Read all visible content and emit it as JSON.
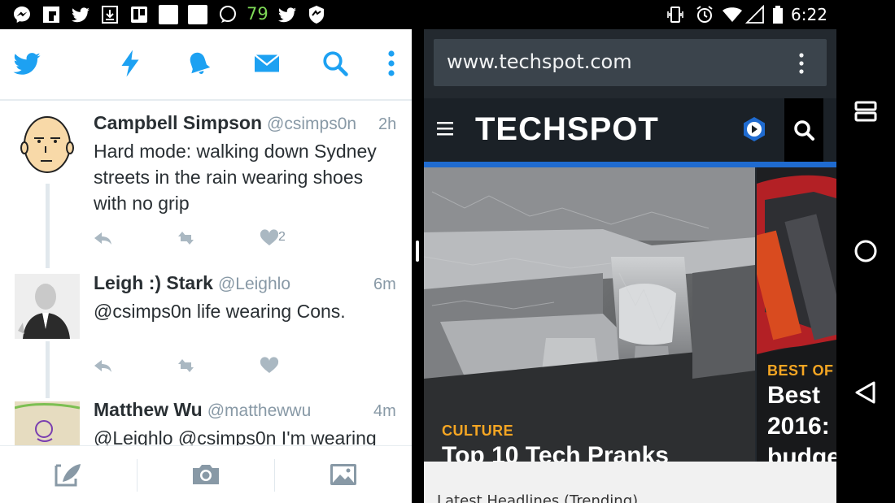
{
  "status_bar": {
    "icons": [
      "messenger-icon",
      "flipboard-icon",
      "twitter-icon",
      "download-icon",
      "trello-icon",
      "blank-square-icon",
      "blank-square-icon",
      "chat-bubble-icon"
    ],
    "notification_count": "79",
    "right_icons": [
      "vibrate-icon",
      "alarm-icon",
      "wifi-icon",
      "cell-signal-icon",
      "battery-icon"
    ],
    "time": "6:22"
  },
  "twitter": {
    "header_icons": [
      "twitter-logo-icon",
      "lightning-icon",
      "notifications-bell-icon",
      "messages-envelope-icon",
      "search-icon",
      "overflow-menu-icon"
    ],
    "accent_color": "#1da1f2",
    "tweets": [
      {
        "name": "Campbell Simpson",
        "handle": "@csimps0n",
        "time": "2h",
        "text_lines": [
          "Hard mode: walking down Sydney",
          "streets in the rain wearing shoes",
          "with no grip"
        ],
        "like_count": "2"
      },
      {
        "name": "Leigh :) Stark",
        "handle": "@Leighlo",
        "time": "6m",
        "text_lines": [
          "@csimps0n life wearing Cons."
        ],
        "like_count": ""
      },
      {
        "name": "Matthew Wu",
        "handle": "@matthewwu",
        "time": "4m",
        "text_lines": [
          "@Leighlo @csimps0n I'm wearing"
        ],
        "like_count": ""
      }
    ],
    "compose_icons": [
      "compose-tweet-icon",
      "camera-icon",
      "gallery-icon"
    ]
  },
  "browser": {
    "url": "www.techspot.com",
    "site_logo": "TECHSPOT",
    "articles": [
      {
        "category": "CULTURE",
        "headline": "Top 10 Tech Pranks"
      },
      {
        "category": "BEST OF",
        "headline_lines": [
          "Best",
          "2016:",
          "budge"
        ]
      }
    ],
    "below_text": "Latest Headlines  (Trending)"
  },
  "nav_bar": {
    "icons": [
      "recents-icon",
      "home-icon",
      "back-icon"
    ]
  }
}
